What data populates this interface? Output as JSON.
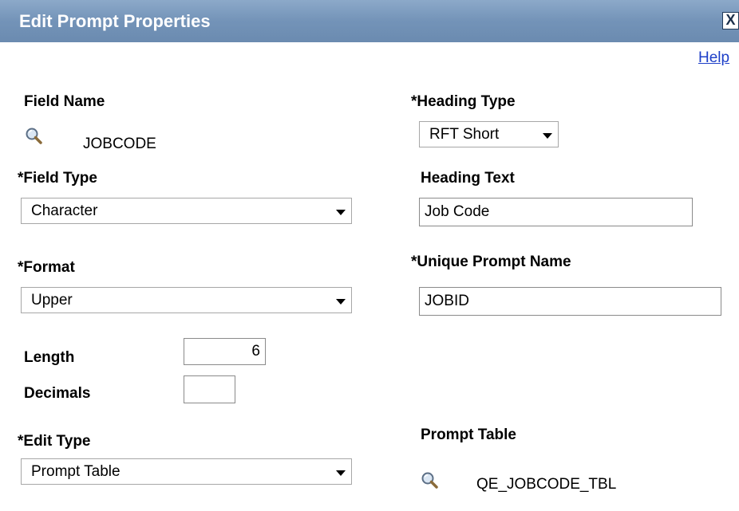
{
  "dialog": {
    "title": "Edit Prompt Properties",
    "close_label": "X",
    "help_label": "Help"
  },
  "field_name": {
    "label": "Field Name",
    "value": "JOBCODE",
    "lookup_icon": "magnifier-icon"
  },
  "heading_type": {
    "label": "*Heading Type",
    "selected": "RFT Short"
  },
  "field_type": {
    "label": "*Field Type",
    "selected": "Character"
  },
  "heading_text": {
    "label": "Heading Text",
    "value": "Job Code"
  },
  "format": {
    "label": "*Format",
    "selected": "Upper"
  },
  "unique_prompt_name": {
    "label": "*Unique Prompt Name",
    "value": "JOBID"
  },
  "length": {
    "label": "Length",
    "value": "6"
  },
  "decimals": {
    "label": "Decimals",
    "value": ""
  },
  "edit_type": {
    "label": "*Edit Type",
    "selected": "Prompt Table"
  },
  "prompt_table": {
    "label": "Prompt Table",
    "value": "QE_JOBCODE_TBL",
    "lookup_icon": "magnifier-icon"
  },
  "colors": {
    "titlebar": "#7393b8",
    "link": "#1d3fc8"
  }
}
